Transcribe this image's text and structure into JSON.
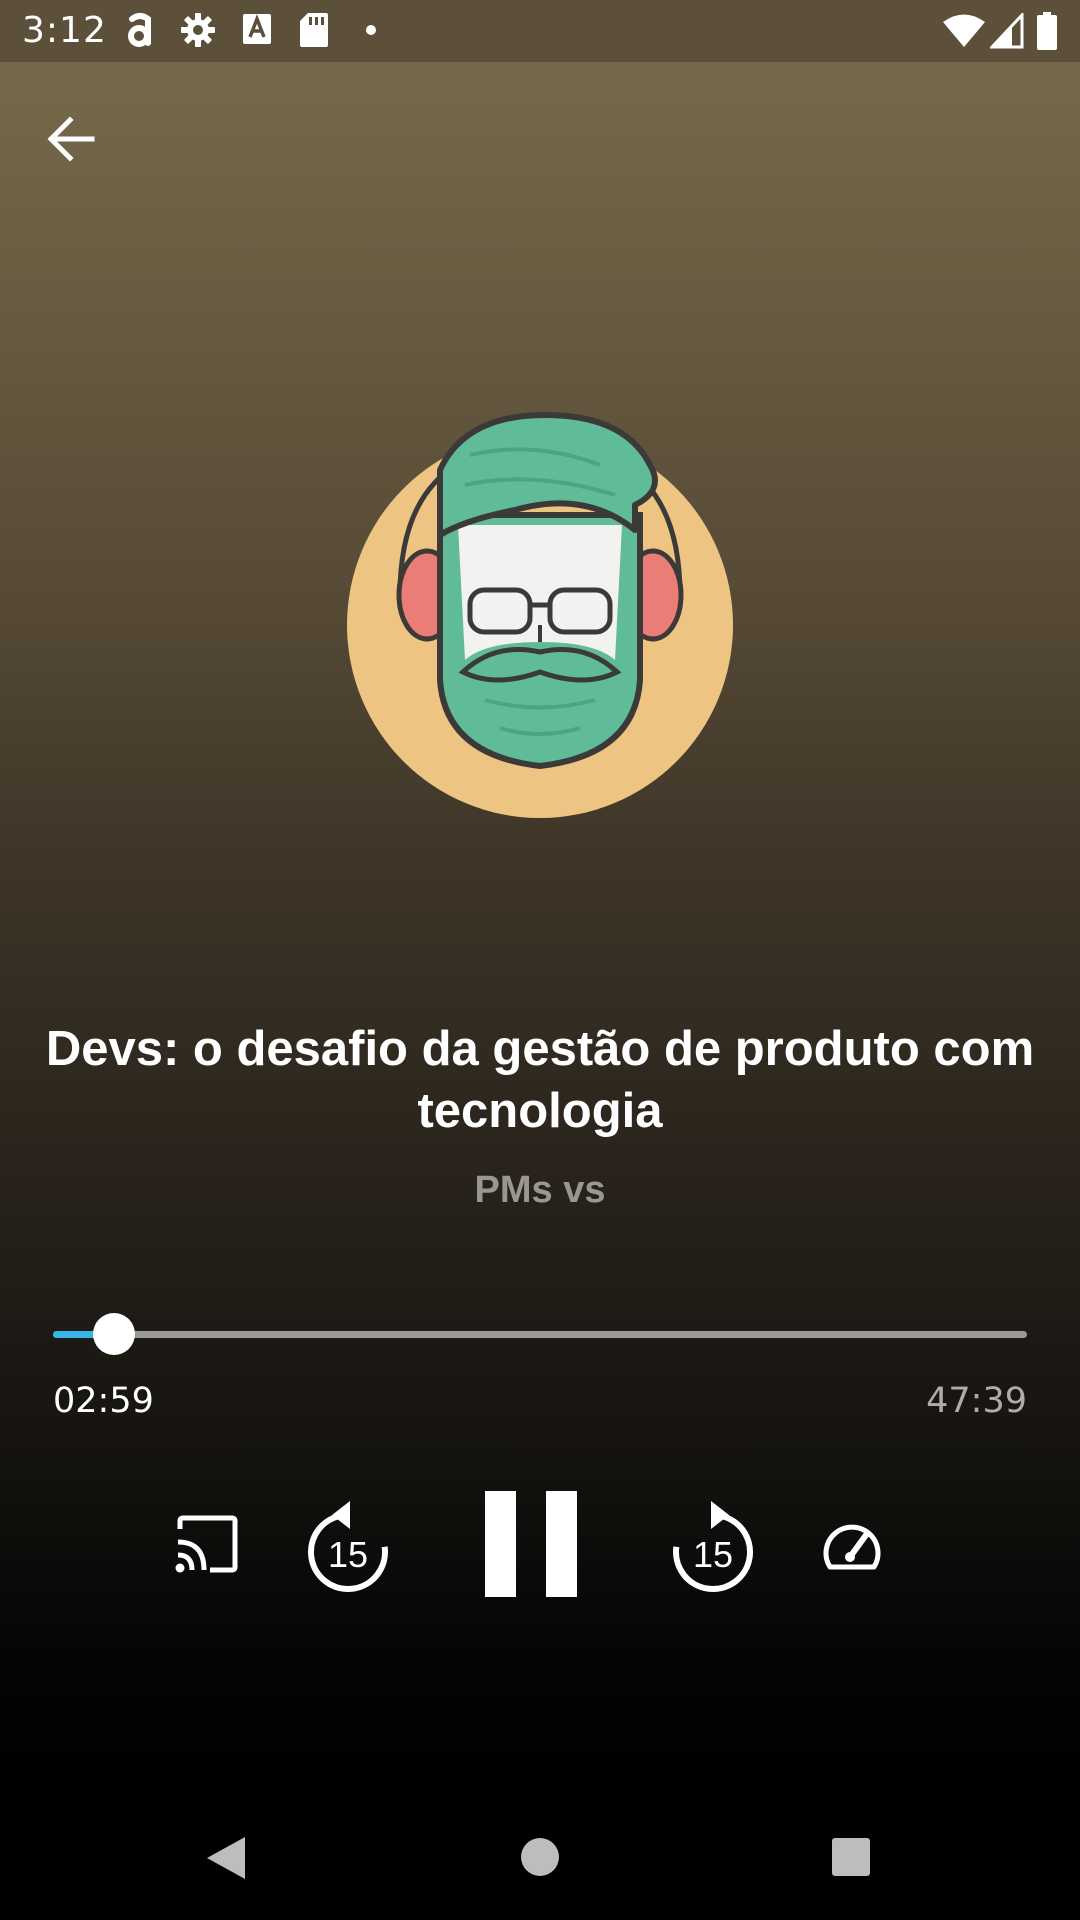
{
  "status_bar": {
    "time": "3:12",
    "icons": [
      "amazon-icon",
      "settings-gear-icon",
      "a-keyboard-icon",
      "sd-card-icon",
      "dot-icon",
      "wifi-icon",
      "signal-icon",
      "battery-icon"
    ]
  },
  "header": {
    "back_icon": "arrow-back-icon"
  },
  "episode": {
    "title": "Devs: o desafio da gestão de produto com tecnologia",
    "podcast": "PMs vs"
  },
  "player": {
    "elapsed": "02:59",
    "total": "47:39",
    "progress_fraction": 0.063,
    "rewind_seconds": "15",
    "forward_seconds": "15",
    "accent_color": "#35b6e6"
  },
  "controls": {
    "icons": [
      "cast-icon",
      "rewind-15-icon",
      "pause-icon",
      "forward-15-icon",
      "playback-speed-icon"
    ]
  },
  "nav_bar": {
    "icons": [
      "nav-back-icon",
      "nav-home-icon",
      "nav-recents-icon"
    ]
  }
}
